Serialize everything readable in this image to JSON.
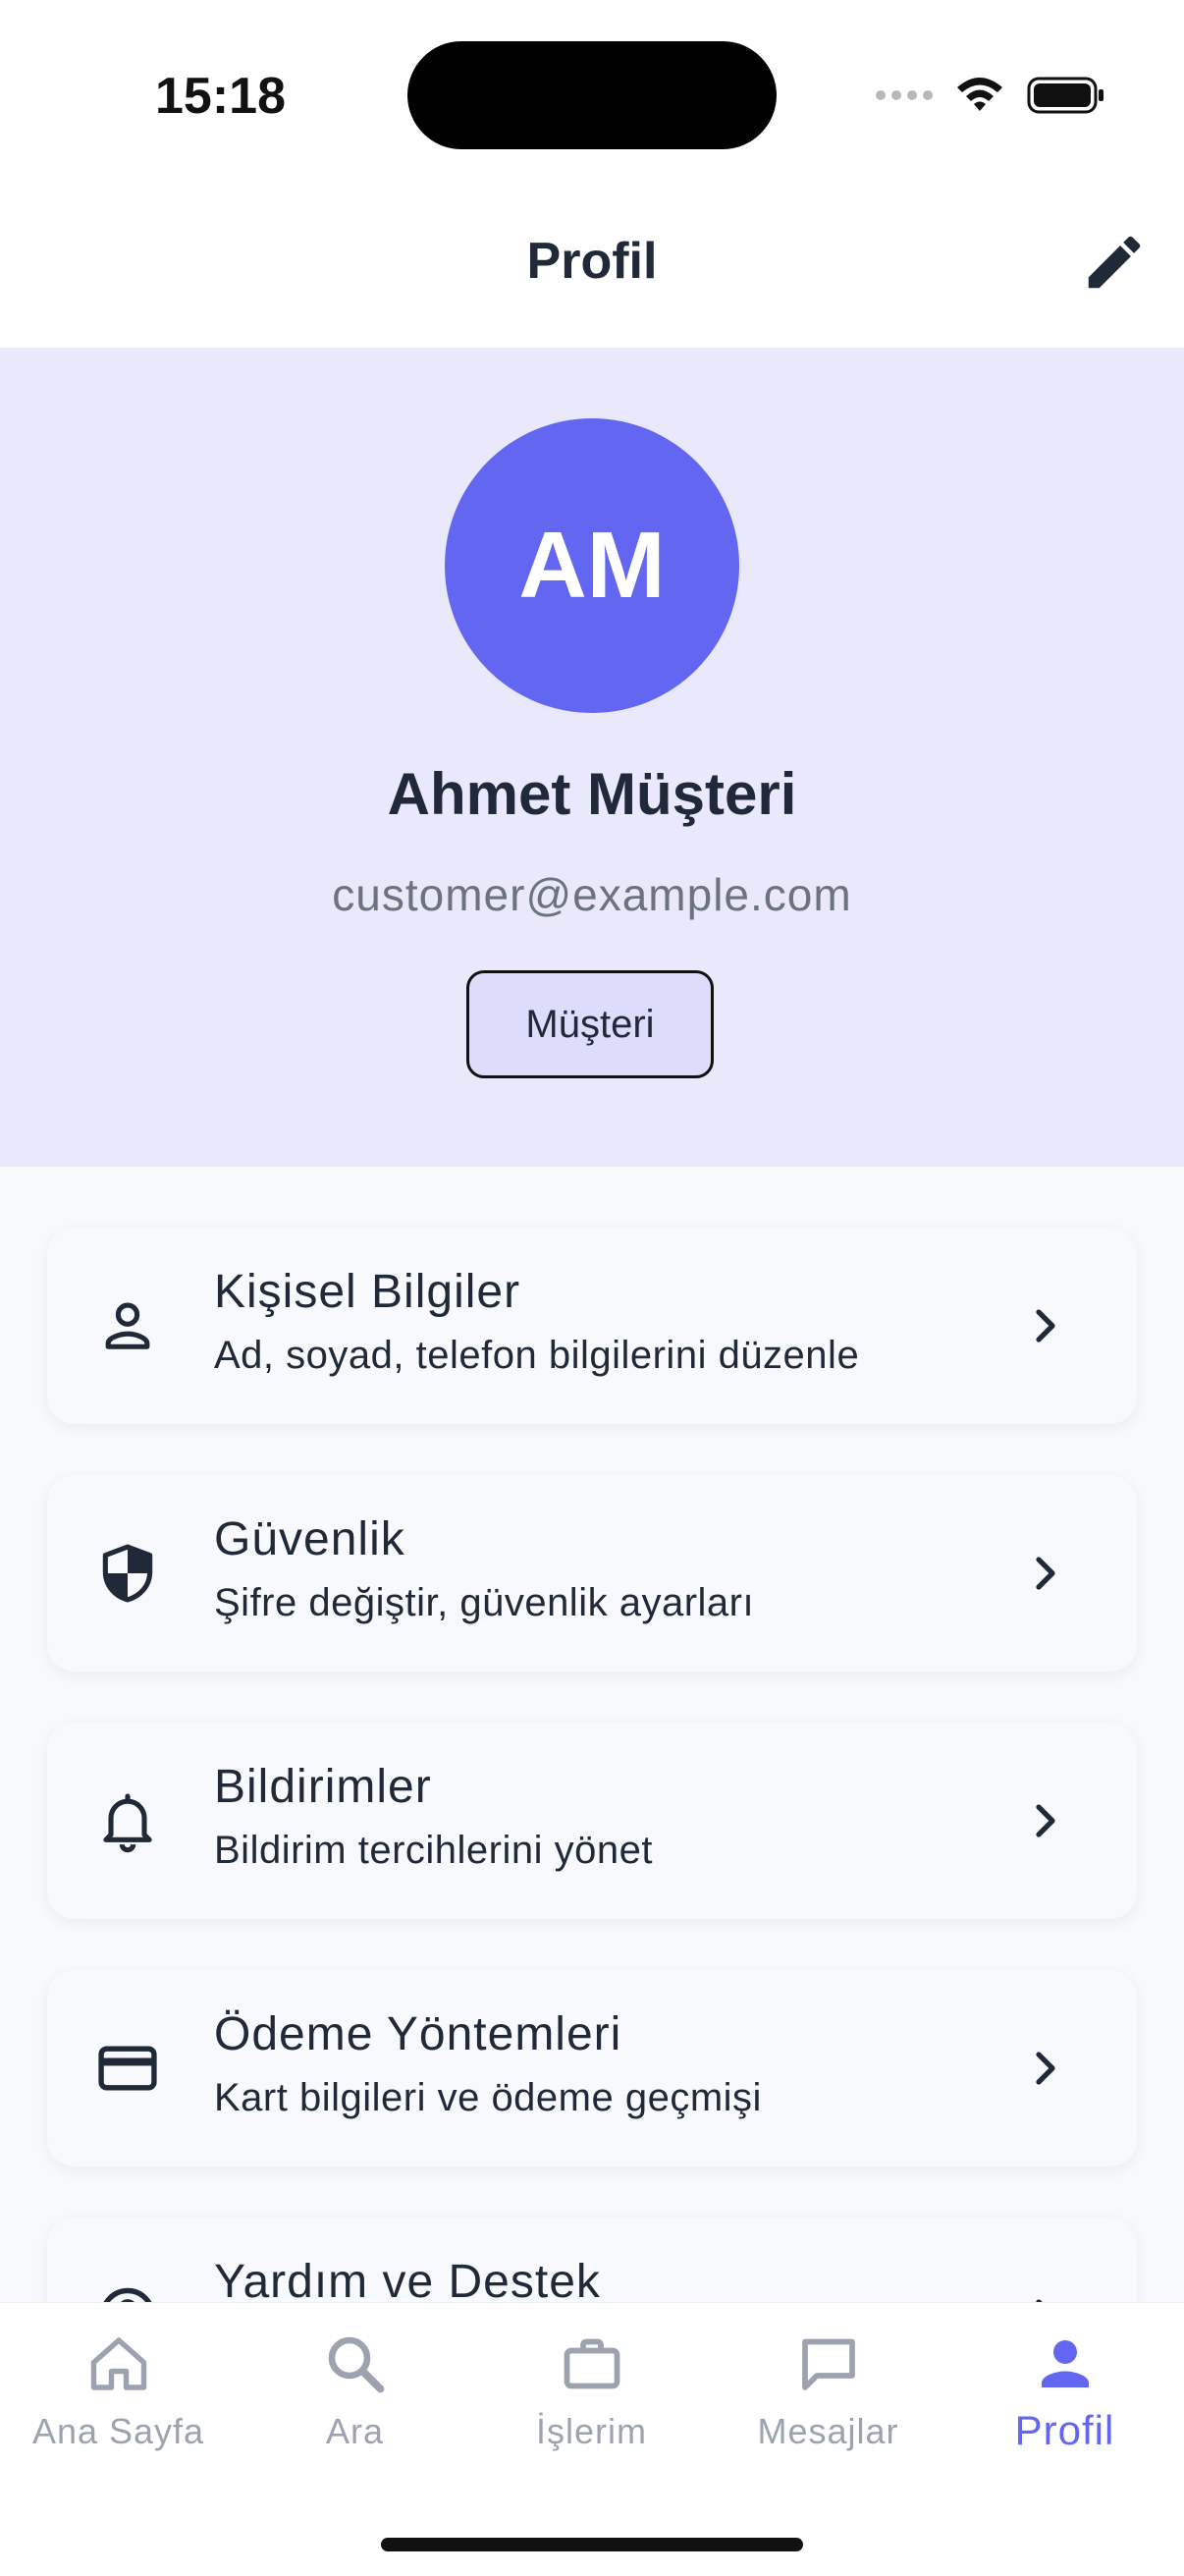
{
  "status_bar": {
    "time": "15:18"
  },
  "header": {
    "title": "Profil",
    "edit_icon": "pencil-icon"
  },
  "profile": {
    "initials": "AM",
    "name": "Ahmet Müşteri",
    "email": "customer@example.com",
    "role": "Müşteri"
  },
  "menu": {
    "items": [
      {
        "title": "Kişisel Bilgiler",
        "subtitle": "Ad, soyad, telefon bilgilerini düzenle",
        "icon": "person-icon"
      },
      {
        "title": "Güvenlik",
        "subtitle": "Şifre değiştir, güvenlik ayarları",
        "icon": "shield-icon"
      },
      {
        "title": "Bildirimler",
        "subtitle": "Bildirim tercihlerini yönet",
        "icon": "bell-icon"
      },
      {
        "title": "Ödeme Yöntemleri",
        "subtitle": "Kart bilgileri ve ödeme geçmişi",
        "icon": "credit-card-icon"
      },
      {
        "title": "Yardım ve Destek",
        "subtitle": "",
        "icon": "help-icon"
      }
    ]
  },
  "bottom_nav": {
    "items": [
      {
        "label": "Ana Sayfa",
        "icon": "home-icon"
      },
      {
        "label": "Ara",
        "icon": "search-icon"
      },
      {
        "label": "İşlerim",
        "icon": "briefcase-icon"
      },
      {
        "label": "Mesajlar",
        "icon": "message-icon"
      },
      {
        "label": "Profil",
        "icon": "person-icon"
      }
    ],
    "active_index": 4
  },
  "colors": {
    "accent": "#6366f1",
    "hero_background": "#e9e9fb",
    "badge_background": "#dedcfb",
    "text_primary": "#1f2937",
    "text_muted": "#6b7280",
    "nav_inactive": "#9ca3af"
  }
}
